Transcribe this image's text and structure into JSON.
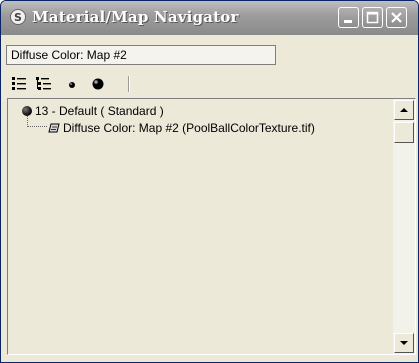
{
  "window": {
    "title": "Material/Map Navigator",
    "icons": {
      "system": "3dsmax-logo-icon",
      "minimize": "minimize-icon",
      "maximize": "maximize-icon",
      "close": "close-icon"
    }
  },
  "path_display": "Diffuse Color: Map #2",
  "toolbar": {
    "buttons": [
      {
        "icon": "view-list-icon"
      },
      {
        "icon": "view-list-icons-icon"
      },
      {
        "icon": "view-small-icons-icon"
      },
      {
        "icon": "view-large-icons-icon"
      }
    ]
  },
  "tree": {
    "items": [
      {
        "label": "13 - Default  ( Standard )",
        "icon": "material-sphere-icon"
      },
      {
        "label": "Diffuse Color: Map #2 (PoolBallColorTexture.tif)",
        "icon": "bitmap-map-icon"
      }
    ]
  },
  "colors": {
    "titlebar": "#9d9d9d",
    "window_bg": "#ece9d8"
  }
}
